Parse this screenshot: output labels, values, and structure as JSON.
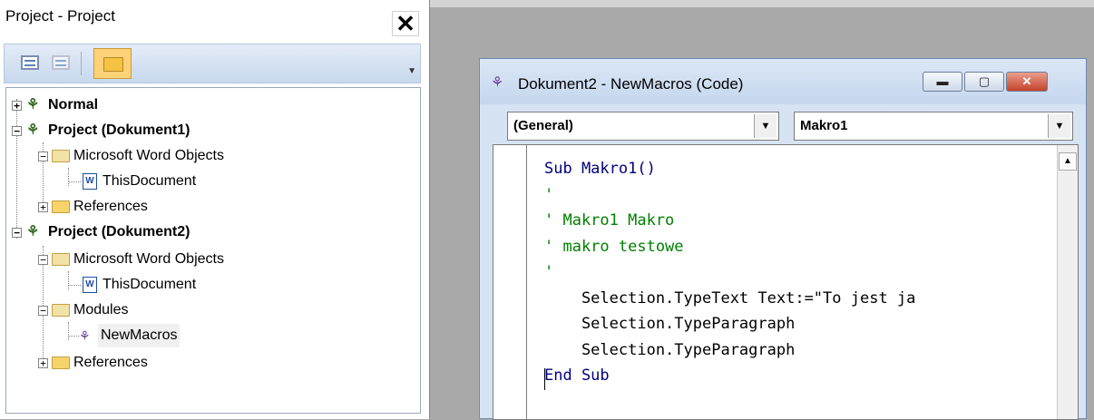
{
  "explorer": {
    "title": "Project - Project",
    "close_label": "✕",
    "tree": [
      {
        "label": "Normal"
      },
      {
        "label": "Project (Dokument1)"
      },
      {
        "label": "Microsoft Word Objects"
      },
      {
        "label": "ThisDocument"
      },
      {
        "label": "References"
      },
      {
        "label": "Project (Dokument2)"
      },
      {
        "label": "Microsoft Word Objects"
      },
      {
        "label": "ThisDocument"
      },
      {
        "label": "Modules"
      },
      {
        "label": "NewMacros"
      },
      {
        "label": "References"
      }
    ]
  },
  "code_window": {
    "title": "Dokument2 - NewMacros (Code)",
    "min_label": "▬",
    "max_label": "▢",
    "close_label": "✕",
    "object_combo": "(General)",
    "procedure_combo": "Makro1",
    "lines": [
      {
        "text": "Sub Makro1()",
        "kind": "kw"
      },
      {
        "text": "'",
        "kind": "cm"
      },
      {
        "text": "' Makro1 Makro",
        "kind": "cm"
      },
      {
        "text": "' makro testowe",
        "kind": "cm"
      },
      {
        "text": "'",
        "kind": "cm"
      },
      {
        "text": "    Selection.TypeText Text:=\"To jest ja",
        "kind": "tx"
      },
      {
        "text": "    Selection.TypeParagraph",
        "kind": "tx"
      },
      {
        "text": "    Selection.TypeParagraph",
        "kind": "tx"
      },
      {
        "text": "End Sub",
        "kind": "kw"
      }
    ]
  },
  "colors": {
    "keyword": "#00007f",
    "comment": "#008000"
  }
}
